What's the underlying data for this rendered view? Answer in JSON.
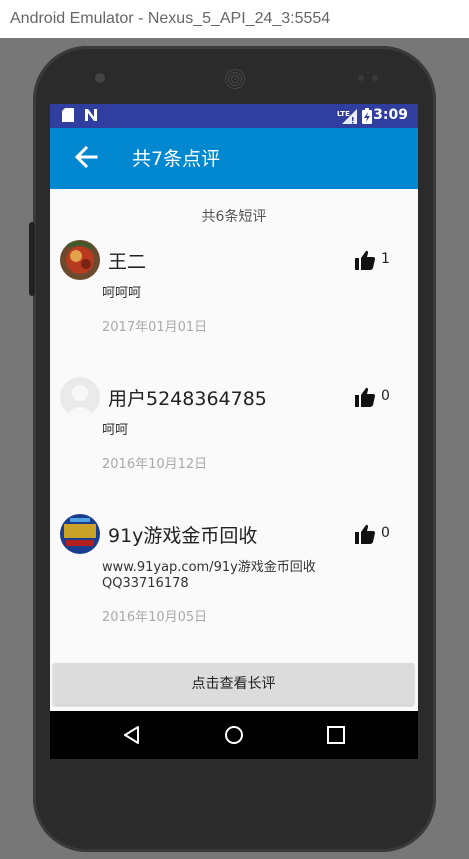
{
  "window": {
    "title": "Android Emulator - Nexus_5_API_24_3:5554"
  },
  "status_bar": {
    "time": "3:09",
    "left_icons": [
      "sd-card-icon",
      "notification-n-icon"
    ],
    "right_icons": [
      "lte-signal-icon",
      "battery-icon"
    ]
  },
  "app_bar": {
    "title": "共7条点评",
    "back_icon": "arrow-back-icon",
    "color": "#0288d1"
  },
  "short_reviews": {
    "count_label": "共6条短评",
    "items": [
      {
        "name": "王二",
        "likes": "1",
        "text": "呵呵呵",
        "date": "2017年01月01日"
      },
      {
        "name": "用户5248364785",
        "likes": "0",
        "text": "呵呵",
        "date": "2016年10月12日"
      },
      {
        "name": "91y游戏金币回收",
        "likes": "0",
        "text_line1": "www.91yap.com/91y游戏金币回收",
        "text_line2": "QQ33716178",
        "date": "2016年10月05日"
      }
    ]
  },
  "long_review_button": {
    "label": "点击查看长评"
  },
  "nav_bar": {
    "buttons": [
      "back-triangle-icon",
      "home-circle-icon",
      "recents-square-icon"
    ]
  }
}
